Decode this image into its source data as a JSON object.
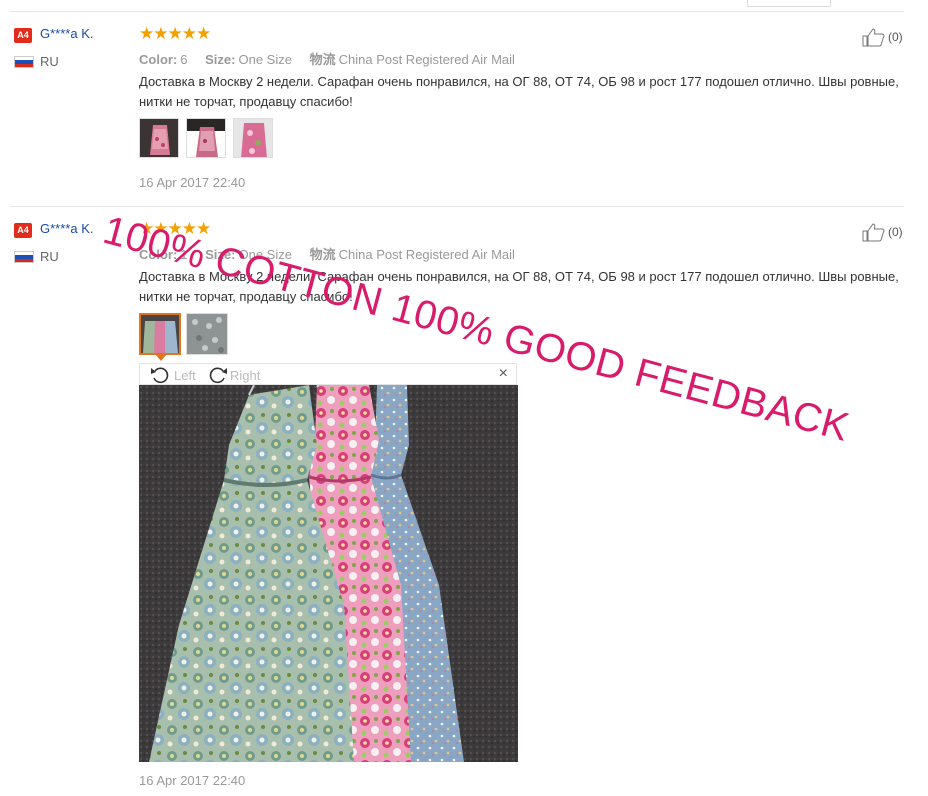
{
  "reviews": [
    {
      "badge": "A4",
      "username": "G****a K.",
      "country": "RU",
      "stars": "★★★★★",
      "color_label": "Color:",
      "color_value": "6",
      "size_label": "Size:",
      "size_value": "One Size",
      "shipping_label": "物流",
      "shipping_value": "China Post Registered Air Mail",
      "text": "Доставка в Москву 2 недели. Сарафан очень понравился, на ОГ 88, ОТ 74, ОБ 98 и рост 177 подошел отлично. Швы ровные, нитки не торчат, продавцу спасибо!",
      "date": "16 Apr 2017 22:40",
      "likes": "(0)",
      "thumb_count": 3
    },
    {
      "badge": "A4",
      "username": "G****a K.",
      "country": "RU",
      "stars": "★★★★★",
      "color_label": "Color:",
      "color_value": "1",
      "size_label": "Size:",
      "size_value": "One Size",
      "shipping_label": "物流",
      "shipping_value": "China Post Registered Air Mail",
      "text": "Доставка в Москву 2 недели. Сарафан очень понравился, на ОГ 88, ОТ 74, ОБ 98 и рост 177 подошел отлично. Швы ровные, нитки не торчат, продавцу спасибо!",
      "date": "16 Apr 2017 22:40",
      "likes": "(0)",
      "thumb_count": 2
    }
  ],
  "viewer": {
    "rotate_left": "Left",
    "rotate_right": "Right",
    "close": "×"
  },
  "watermark": "100% COTTON 100% GOOD FEEDBACK",
  "colors": {
    "accent": "#e0761b",
    "star": "#f2a100",
    "badge": "#e22c1b",
    "watermark": "#d81b6a",
    "username": "#1a4ba6"
  }
}
